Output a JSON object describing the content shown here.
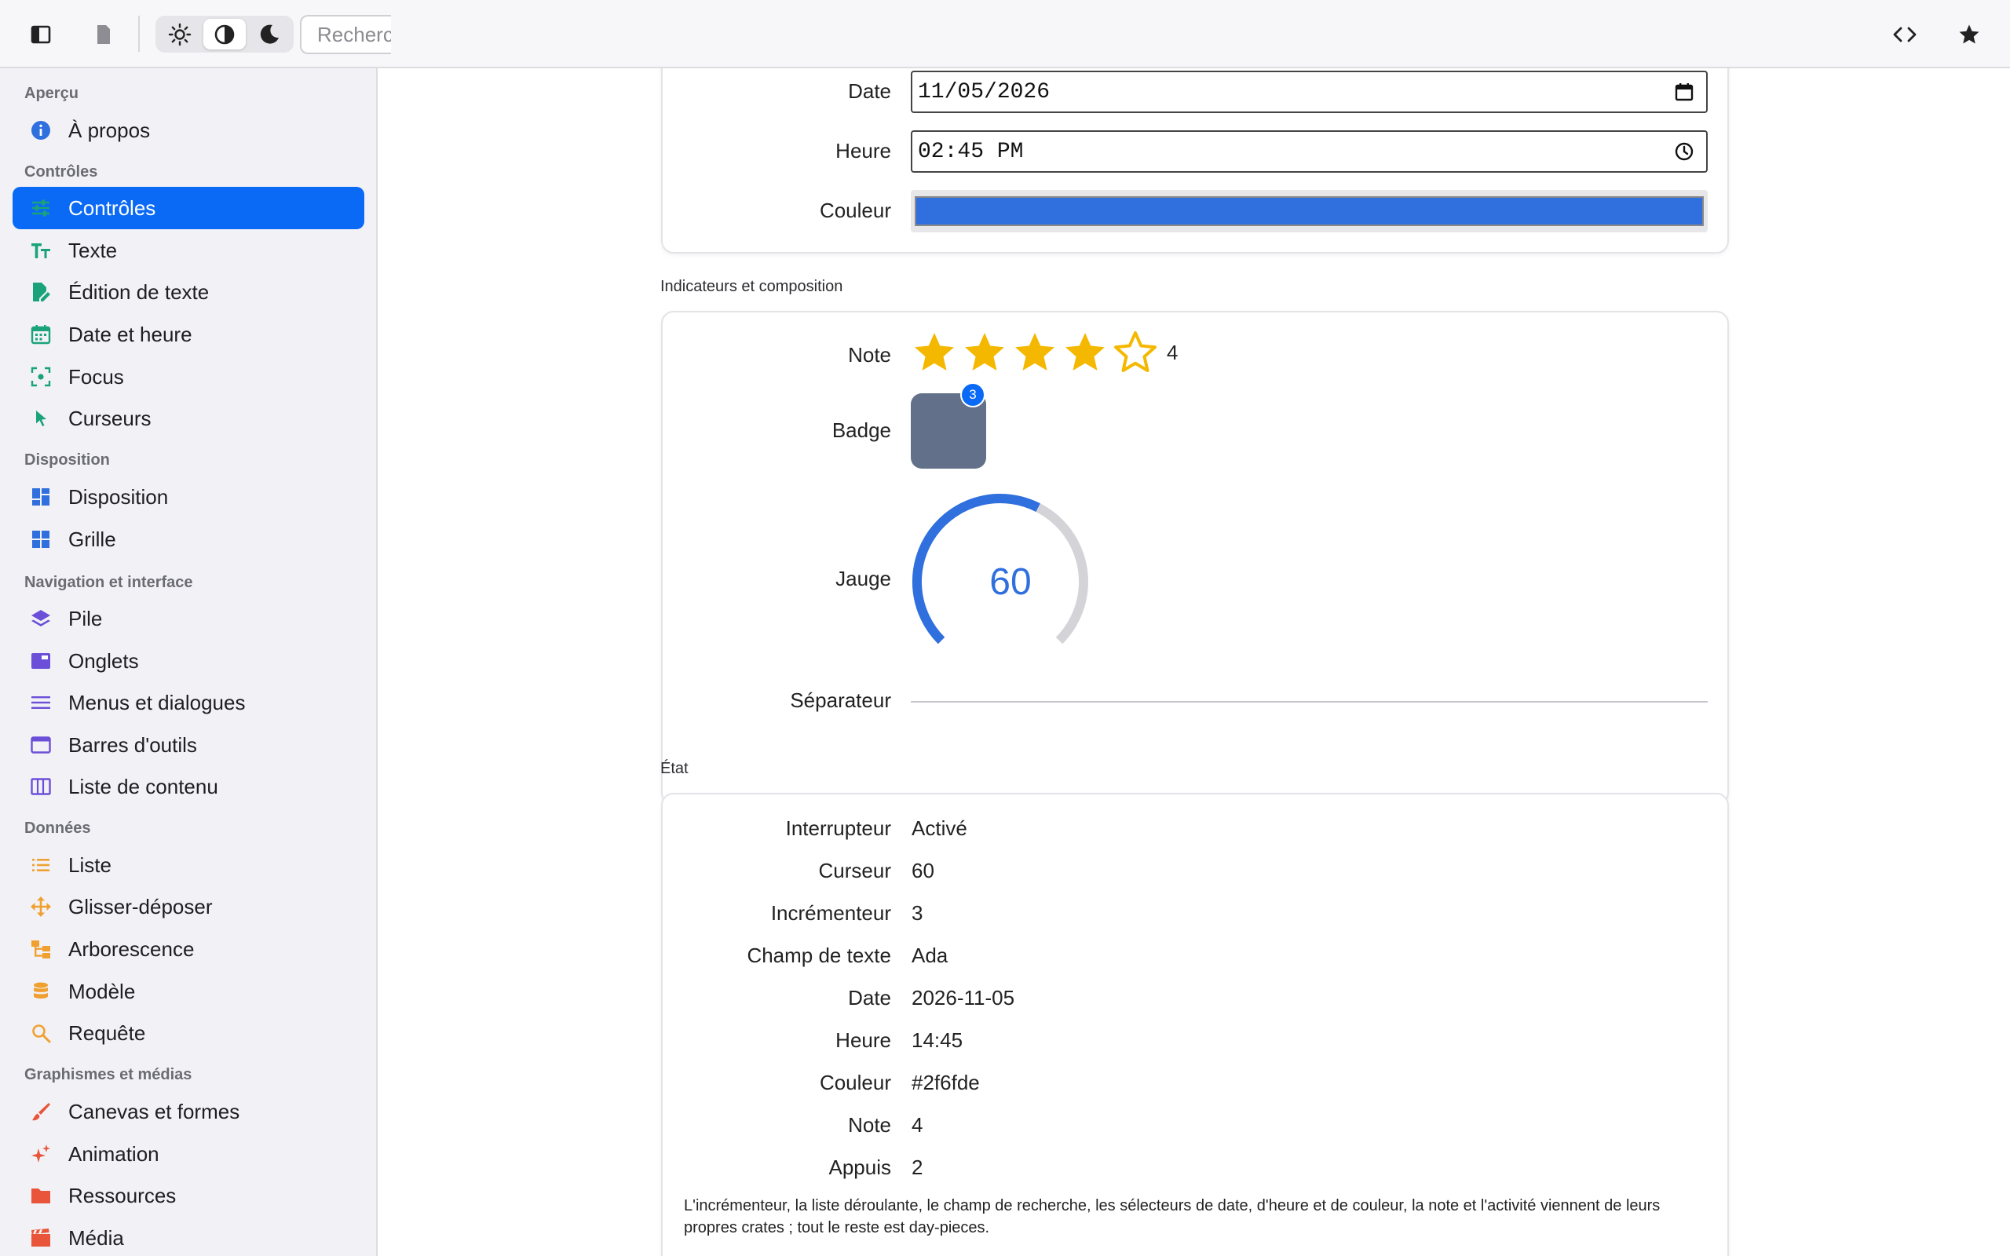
{
  "topbar": {
    "search_placeholder": "Recherc"
  },
  "sidebar": {
    "sections": [
      {
        "title": "Aperçu"
      },
      {
        "title": "Contrôles"
      },
      {
        "title": "Disposition"
      },
      {
        "title": "Navigation et interface"
      },
      {
        "title": "Données"
      },
      {
        "title": "Graphismes et médias"
      }
    ],
    "items": [
      {
        "label": "À propos"
      },
      {
        "label": "Contrôles"
      },
      {
        "label": "Texte"
      },
      {
        "label": "Édition de texte"
      },
      {
        "label": "Date et heure"
      },
      {
        "label": "Focus"
      },
      {
        "label": "Curseurs"
      },
      {
        "label": "Disposition"
      },
      {
        "label": "Grille"
      },
      {
        "label": "Pile"
      },
      {
        "label": "Onglets"
      },
      {
        "label": "Menus et dialogues"
      },
      {
        "label": "Barres d'outils"
      },
      {
        "label": "Liste de contenu"
      },
      {
        "label": "Liste"
      },
      {
        "label": "Glisser-déposer"
      },
      {
        "label": "Arborescence"
      },
      {
        "label": "Modèle"
      },
      {
        "label": "Requête"
      },
      {
        "label": "Canevas et formes"
      },
      {
        "label": "Animation"
      },
      {
        "label": "Ressources"
      },
      {
        "label": "Média"
      }
    ],
    "active_item": "Contrôles",
    "accent": "#0a6af5"
  },
  "pickers": {
    "date_label": "Date",
    "date_value": "11/05/2026",
    "time_label": "Heure",
    "time_value": "02:45 PM",
    "color_label": "Couleur",
    "color_value": "#2f6fde"
  },
  "indicators": {
    "section_title": "Indicateurs et composition",
    "rating_label": "Note",
    "rating_value": 4,
    "rating_max": 5,
    "rating_text": "4",
    "badge_label": "Badge",
    "badge_count": "3",
    "gauge_label": "Jauge",
    "gauge_value": "60",
    "gauge_fraction": 0.6,
    "separator_label": "Séparateur"
  },
  "state": {
    "section_title": "État",
    "rows": [
      {
        "label": "Interrupteur",
        "value": "Activé"
      },
      {
        "label": "Curseur",
        "value": "60"
      },
      {
        "label": "Incrémenteur",
        "value": "3"
      },
      {
        "label": "Champ de texte",
        "value": "Ada"
      },
      {
        "label": "Date",
        "value": "2026-11-05"
      },
      {
        "label": "Heure",
        "value": "14:45"
      },
      {
        "label": "Couleur",
        "value": "#2f6fde"
      },
      {
        "label": "Note",
        "value": "4"
      },
      {
        "label": "Appuis",
        "value": "2"
      }
    ],
    "note": "L'incrémenteur, la liste déroulante, le champ de recherche, les sélecteurs de date, d'heure et de couleur, la note et l'activité viennent de leurs propres crates ; tout le reste est day-pieces."
  }
}
